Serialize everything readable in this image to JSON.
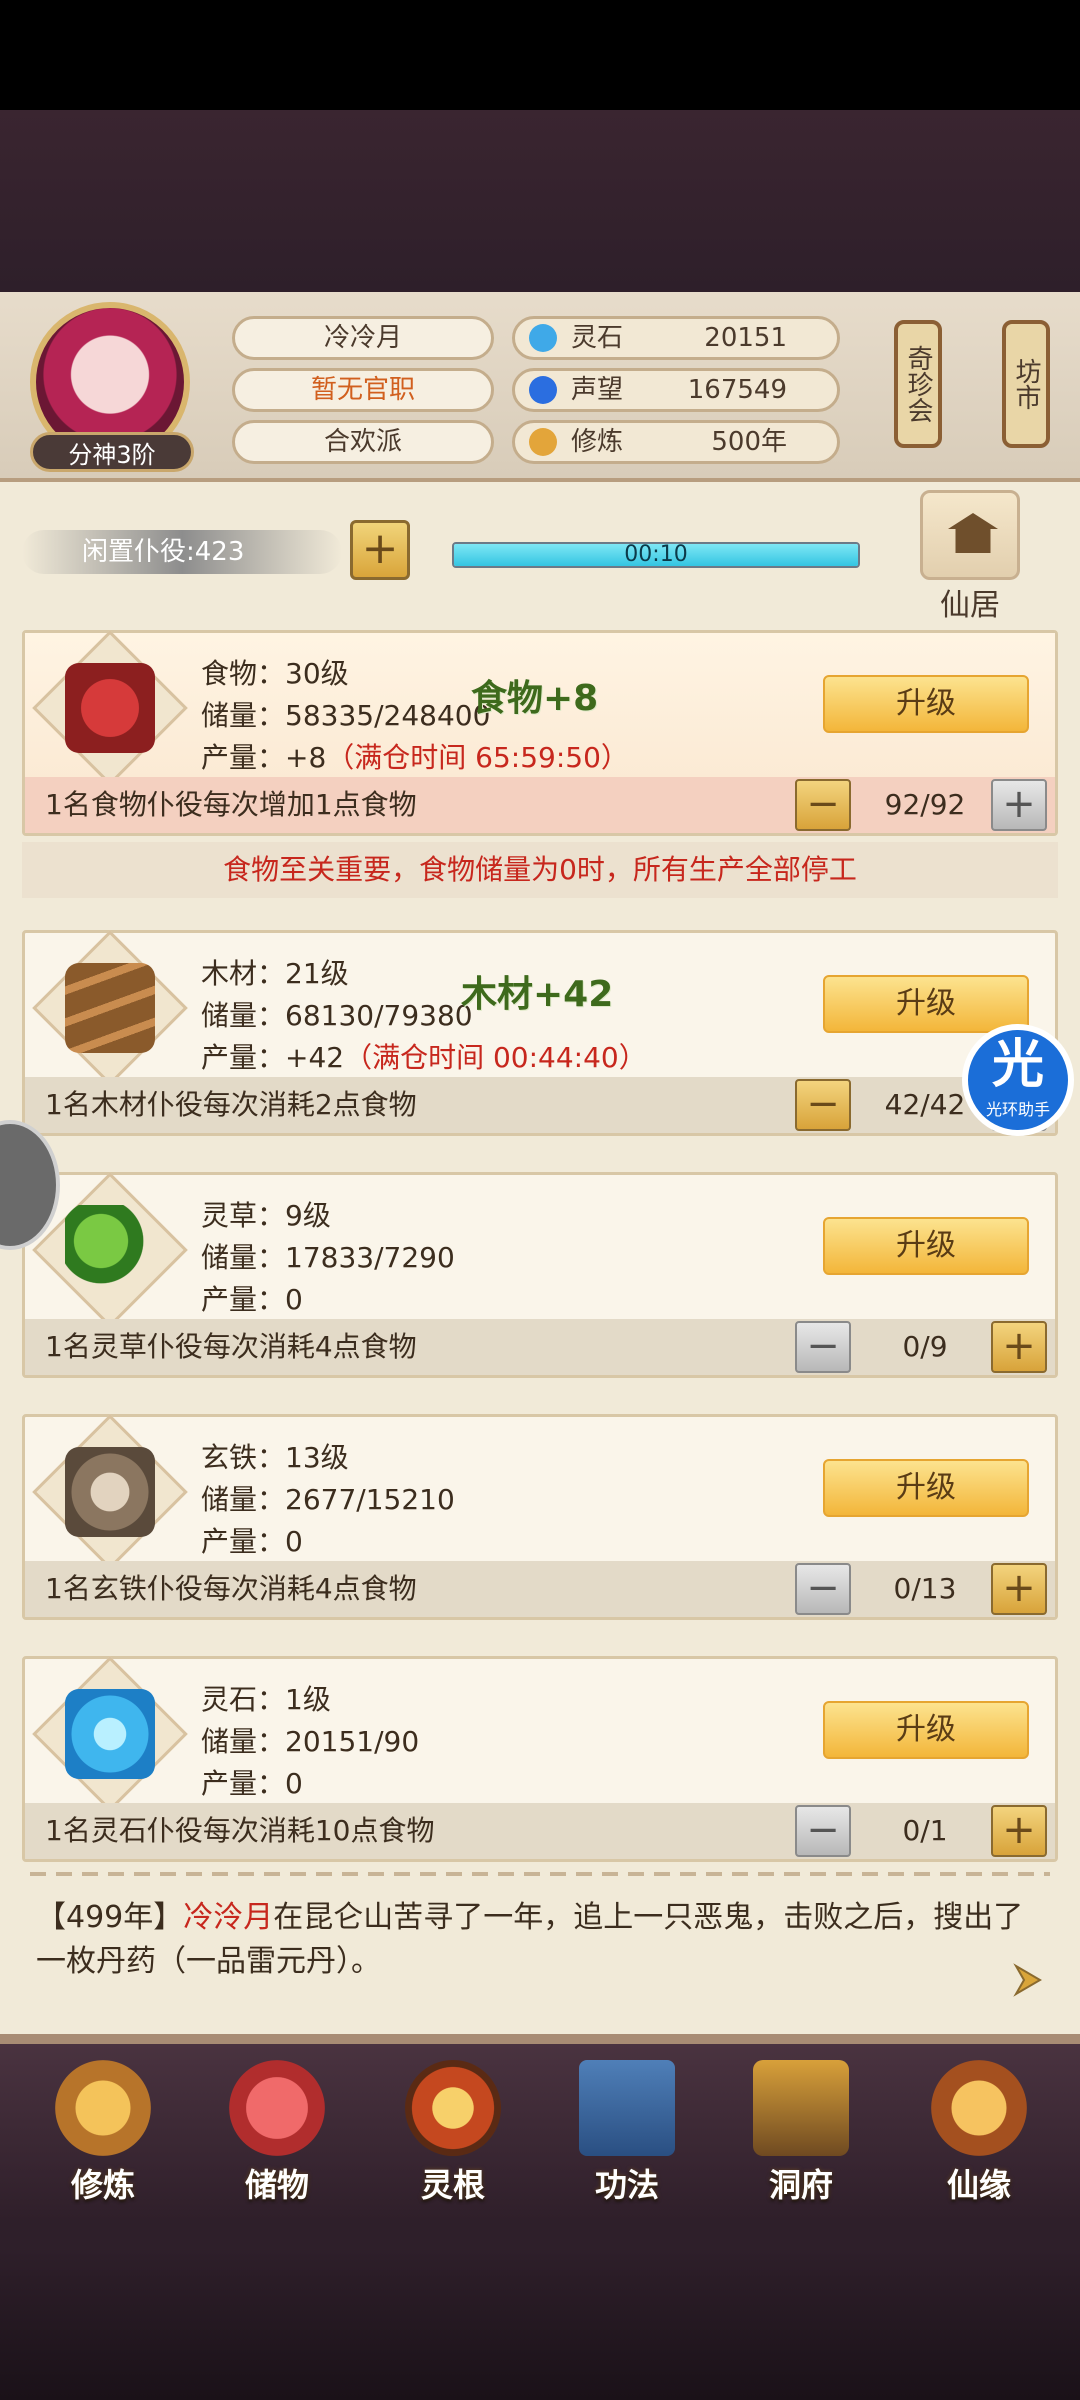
{
  "header": {
    "rank": "分神3阶",
    "name": "冷冷月",
    "office": "暂无官职",
    "sect": "合欢派",
    "resources": [
      {
        "label": "灵石",
        "value": "20151",
        "icon": "spirit-stone-icon",
        "color": "#3fa9e8"
      },
      {
        "label": "声望",
        "value": "167549",
        "icon": "reputation-icon",
        "color": "#2b6ee0"
      },
      {
        "label": "修炼",
        "value": "500年",
        "icon": "meditation-icon",
        "color": "#e3a53a"
      }
    ],
    "side_buttons": [
      "奇珍会",
      "坊市"
    ]
  },
  "servants": {
    "label": "闲置仆役:423",
    "timer": "00:10",
    "progress": 1.0
  },
  "xianju_label": "仙居",
  "cards": [
    {
      "key": "food",
      "stat_name": "食物：30级",
      "storage": "储量：58335/248400",
      "output": "产量：+8",
      "full_time": "（满仓时间 65:59:50）",
      "float": "食物+8",
      "upgrade": "升级",
      "desc": "1名食物仆役每次增加1点食物",
      "count": "92/92",
      "icon": "meat-icon"
    },
    {
      "key": "wood",
      "stat_name": "木材：21级",
      "storage": "储量：68130/79380",
      "output": "产量：+42",
      "full_time": "（满仓时间 00:44:40）",
      "float": "木材+42",
      "upgrade": "升级",
      "desc": "1名木材仆役每次消耗2点食物",
      "count": "42/42",
      "icon": "wood-logs-icon"
    },
    {
      "key": "herb",
      "stat_name": "灵草：9级",
      "storage": "储量：17833/7290",
      "output": "产量：0",
      "upgrade": "升级",
      "desc": "1名灵草仆役每次消耗4点食物",
      "count": "0/9",
      "icon": "herb-icon"
    },
    {
      "key": "iron",
      "stat_name": "玄铁：13级",
      "storage": "储量：2677/15210",
      "output": "产量：0",
      "upgrade": "升级",
      "desc": "1名玄铁仆役每次消耗4点食物",
      "count": "0/13",
      "icon": "iron-ore-icon"
    },
    {
      "key": "stone",
      "stat_name": "灵石：1级",
      "storage": "储量：20151/90",
      "output": "产量：0",
      "upgrade": "升级",
      "desc": "1名灵石仆役每次消耗10点食物",
      "count": "0/1",
      "icon": "crystal-icon"
    }
  ],
  "warning": "食物至关重要，食物储量为0时，所有生产全部停工",
  "log": {
    "year": "【499年】",
    "name": "冷泠月",
    "text": "在昆仑山苦寻了一年，追上一只恶鬼，击败之后，搜出了一枚丹药（一品雷元丹）。"
  },
  "helper": {
    "big": "光",
    "small": "光环助手"
  },
  "nav": [
    {
      "label": "修炼",
      "icon": "meditation-nav-icon"
    },
    {
      "label": "储物",
      "icon": "bag-icon"
    },
    {
      "label": "灵根",
      "icon": "spirit-root-icon"
    },
    {
      "label": "功法",
      "icon": "book-icon"
    },
    {
      "label": "洞府",
      "icon": "cave-palace-icon"
    },
    {
      "label": "仙缘",
      "icon": "gourd-icon"
    }
  ]
}
